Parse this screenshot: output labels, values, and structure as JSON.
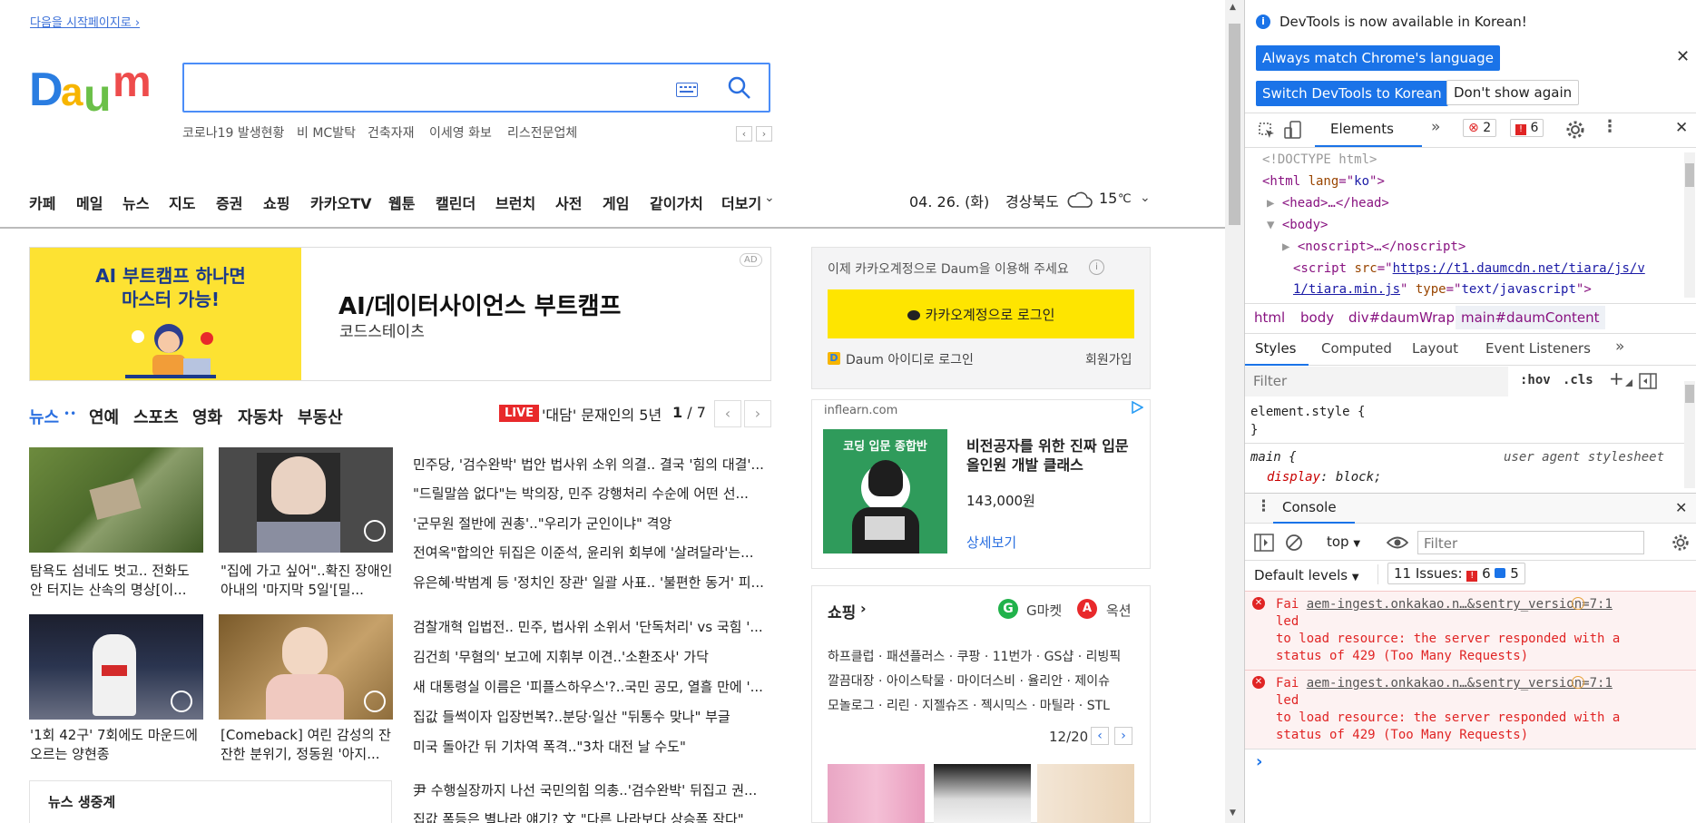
{
  "page": {
    "start_link": "다음을 시작페이지로 ›",
    "trending": [
      "코로나19 발생현황",
      "비 MC발탁",
      "건축자재",
      "이세영 화보",
      "리스전문업체"
    ],
    "trend_prev": "‹",
    "trend_next": "›",
    "gnb": [
      "카페",
      "메일",
      "뉴스",
      "지도",
      "증권",
      "쇼핑",
      "카카오TV",
      "웹툰",
      "캘린더",
      "브런치",
      "사전",
      "게임",
      "같이가치",
      "더보기"
    ],
    "date": "04. 26. (화)",
    "region": "경상북도",
    "temp": "15",
    "temp_unit": "℃",
    "ad_badge": "AD",
    "ad": {
      "img_line1": "AI 부트캠프 하나면",
      "img_line2": "마스터 가능!",
      "title": "AI/데이터사이언스 부트캠프",
      "sub": "코드스테이츠"
    },
    "login": {
      "note": "이제 카카오계정으로 Daum을 이용해 주세요",
      "button": "카카오계정으로 로그인",
      "daum_id": "Daum 아이디로 로그인",
      "signup": "회원가입"
    },
    "news_tabs": [
      "뉴스",
      "연예",
      "스포츠",
      "영화",
      "자동차",
      "부동산"
    ],
    "live_label": "LIVE",
    "live_text": "'대담' 문재인의 5년",
    "page_current": "1",
    "page_total": "/ 7",
    "captions": [
      "탐욕도 섬네도 벗고.. 전화도 안 터지는 산속의 명상[이...",
      "\"집에 가고 싶어\"..확진 장애인 아내의 '마지막 5일'[밀...",
      "'1회 42구' 7회에도 마운드에 오르는 양현종",
      "[Comeback] 여린 감성의 잔잔한 분위기, 정동원 '아지..."
    ],
    "headlines_a": [
      "민주당, '검수완박' 법안 법사위 소위 의결.. 결국 '힘의 대결'...",
      "\"드릴말씀 없다\"는 박의장, 민주 강행처리 수순에 어떤 선...",
      "'군무원 절반에 권총'..\"우리가 군인이냐\" 격앙",
      "전여옥\"합의안 뒤집은 이준석, 윤리위 회부에 '살려달라'는...",
      "유은혜·박범계 등 '정치인 장관' 일괄 사표.. '불편한 동거' 피..."
    ],
    "headlines_b": [
      "검찰개혁 입법전.. 민주, 법사위 소위서 '단독처리' vs 국힘 '...",
      "김건희 '무혐의' 보고에 지휘부 이견..'소환조사' 가닥",
      "새 대통령실 이름은 '피플스하우스'?..국민 공모, 열흘 만에 '...",
      "집값 들썩이자 입장번복?..분당·일산 \"뒤통수 맞나\" 부글",
      "미국 돌아간 뒤 기차역 폭격..\"3차 대전 날 수도\""
    ],
    "headlines_c": [
      "尹 수행실장까지 나선 국민의힘 의총..'검수완박' 뒤집고 권...",
      "집값 폭등은 별나라 얘기? 文 \"다른 나라보다 상승폭 작다\""
    ],
    "news_live": "뉴스 생중계",
    "ad2": {
      "domain": "inflearn.com",
      "img_text": "코딩 입문 종합반",
      "title": "비전공자를 위한 진짜 입문 올인원 개발 클래스",
      "price": "143,000원",
      "more": "상세보기"
    },
    "shopping": {
      "title": "쇼핑",
      "gmarket": "G마켓",
      "auction": "옥션",
      "line1": "하프클럽 · 패션플러스 · 쿠팡 · 11번가 · GS샵 · 리빙픽",
      "line2": "깔끔대장 · 아이스탁물 · 마이더스비 · 율리안 · 제이슈",
      "line3": "모놀로그 · 리린 · 지젤슈즈 · 젝시믹스 · 마틸라 · STL",
      "counter": "12/20"
    }
  },
  "devtools": {
    "banner": "DevTools is now available in Korean!",
    "btn_match": "Always match Chrome's language",
    "btn_switch": "Switch DevTools to Korean",
    "btn_dont": "Don't show again",
    "tab_elements": "Elements",
    "err_count": "2",
    "warn_count": "6",
    "dom": {
      "doctype": "<!DOCTYPE html>",
      "html_lang": "ko",
      "head": "<head>…</head>",
      "body": "<body>",
      "noscript": "<noscript>…</noscript>",
      "script_src": "https://t1.daumcdn.net/tiara/js/v1/tiara.min.js",
      "script_src_l1": "https://t1.daumcdn.net/tiara/js/v",
      "script_src_l2": "1/tiara.min.js",
      "script_type": "text/javascript"
    },
    "breadcrumbs": [
      "html",
      "body",
      "div#daumWrap",
      "main#daumContent"
    ],
    "style_tabs": [
      "Styles",
      "Computed",
      "Layout",
      "Event Listeners"
    ],
    "filter_placeholder": "Filter",
    "hov": ":hov",
    "cls": ".cls",
    "element_style": "element.style {",
    "close_brace": "}",
    "main_rule": "main {",
    "ua": "user agent stylesheet",
    "display_prop": "display",
    "display_val": "block;",
    "console_tab": "Console",
    "context": "top",
    "console_filter": "Filter",
    "levels": "Default levels",
    "issues_label": "11 Issues:",
    "issues_err": "6",
    "issues_info": "5",
    "errors": [
      {
        "pre": "Fai",
        "link": "aem-ingest.onkakao.n…&sentry_version=7:1",
        "l2": "led",
        "l3": "to load resource: the server responded with a",
        "l4": "status of 429 (Too Many Requests)"
      },
      {
        "pre": "Fai",
        "link": "aem-ingest.onkakao.n…&sentry_version=7:1",
        "l2": "led",
        "l3": "to load resource: the server responded with a",
        "l4": "status of 429 (Too Many Requests)"
      }
    ],
    "prompt": "›"
  }
}
